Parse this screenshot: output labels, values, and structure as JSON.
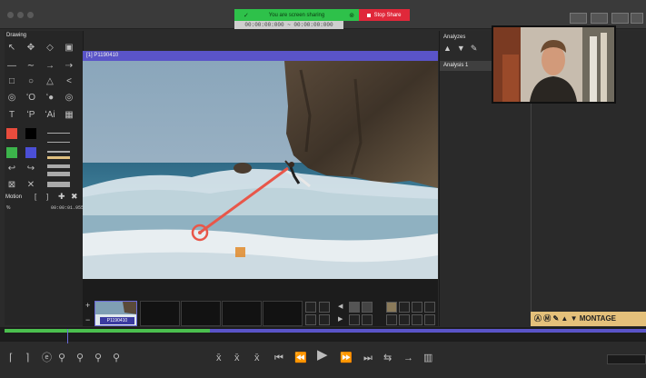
{
  "screen_share": {
    "status_text": "You are screen sharing",
    "stop_label": "Stop Share",
    "timecode": "00:00:00:000 ~ 00:00:00:000"
  },
  "drawing": {
    "title": "Drawing",
    "motion_label": "Motion",
    "motion_percent": "%",
    "motion_time": "00:00:01.955",
    "colors": {
      "red": "#e84c3d",
      "black": "#000000",
      "green": "#3cb44b",
      "blue": "#4b4fd6"
    }
  },
  "video": {
    "title": "[1] P1190410"
  },
  "analyzes": {
    "title": "Analyzes",
    "items": [
      "Analysis 1"
    ]
  },
  "thumbnails": {
    "selected_label": "P1190410"
  },
  "montage": {
    "label": "MONTAGE"
  },
  "timeline": {
    "progress_fraction": 0.32
  },
  "colors": {
    "accent_purple": "#5a54c8",
    "share_green": "#2ec14a",
    "stop_red": "#e0283a",
    "montage_gold": "#e4c07a"
  }
}
